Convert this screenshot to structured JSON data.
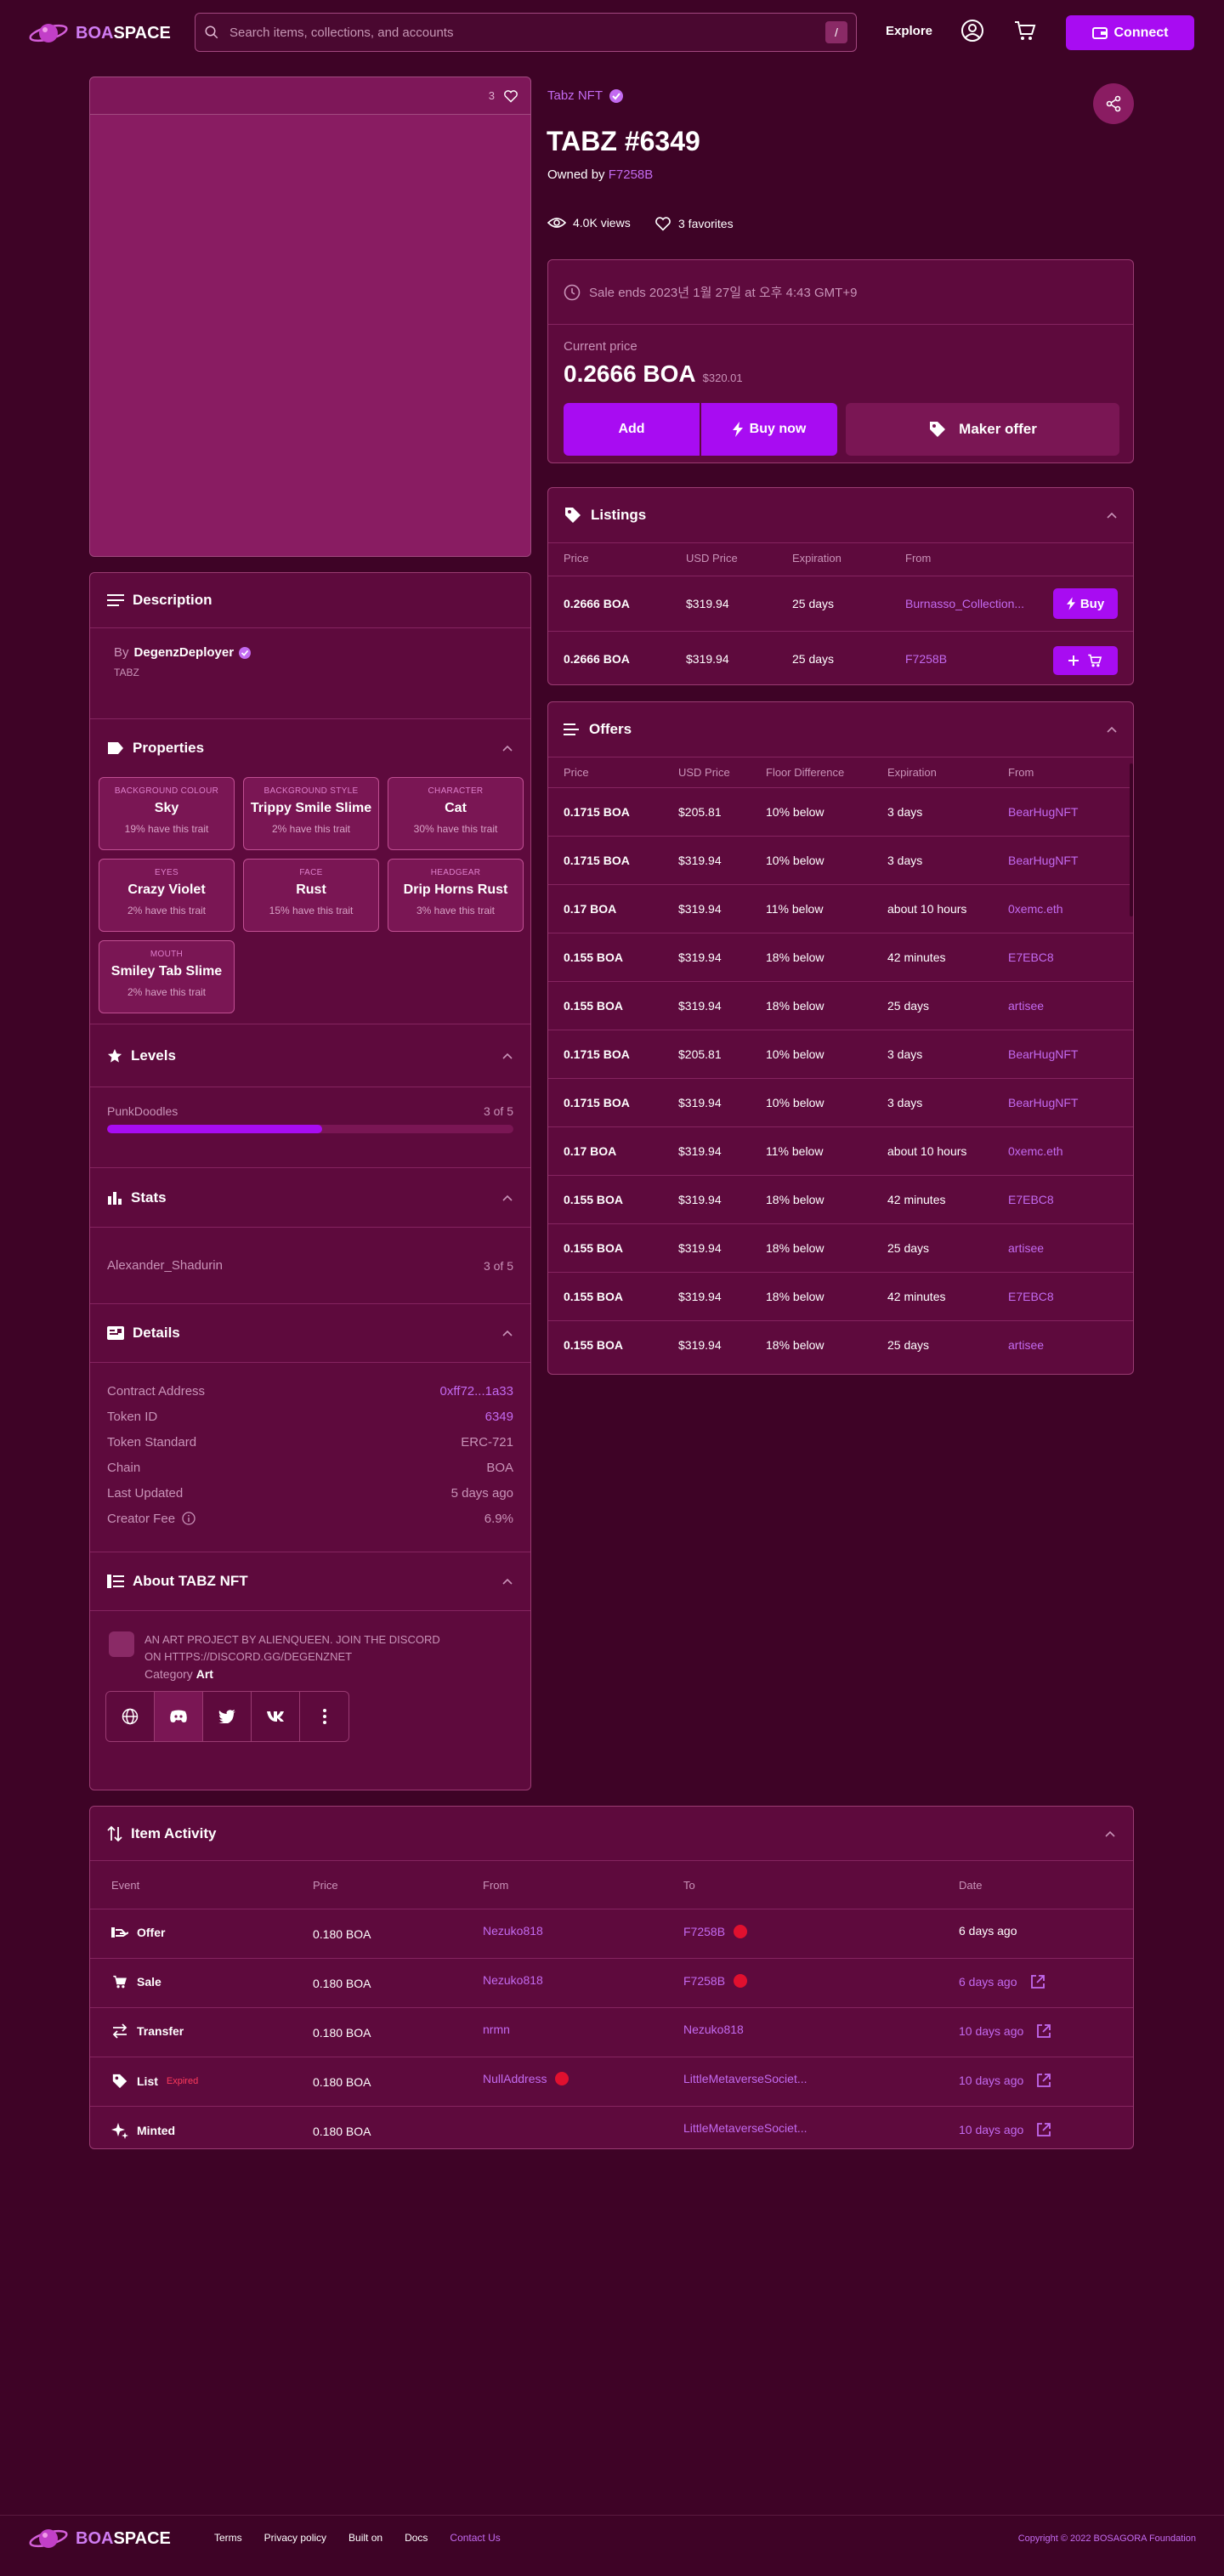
{
  "header": {
    "logo_boa": "BOA",
    "logo_space": "SPACE",
    "search_placeholder": "Search items, collections, and accounts",
    "search_shortcut": "/",
    "nav_explore": "Explore",
    "connect_label": "Connect"
  },
  "media": {
    "favorite_count": "3"
  },
  "item": {
    "collection": "Tabz NFT",
    "title": "TABZ #6349",
    "owned_by_label": "Owned by",
    "owner": "F7258B",
    "views": "4.0K views",
    "favorites": "3 favorites"
  },
  "sale": {
    "ends": "Sale ends 2023년 1월 27일 at 오후 4:43 GMT+9",
    "current_price_label": "Current price",
    "price": "0.2666 BOA",
    "usd": "$320.01",
    "add_label": "Add",
    "buy_now_label": "Buy now",
    "make_offer_label": "Maker offer"
  },
  "listings": {
    "title": "Listings",
    "headers": [
      "Price",
      "USD Price",
      "Expiration",
      "From"
    ],
    "rows": [
      {
        "price": "0.2666 BOA",
        "usd": "$319.94",
        "exp": "25 days",
        "from": "Burnasso_Collection...",
        "action": "Buy"
      },
      {
        "price": "0.2666 BOA",
        "usd": "$319.94",
        "exp": "25 days",
        "from": "F7258B",
        "action": ""
      }
    ]
  },
  "offers": {
    "title": "Offers",
    "headers": [
      "Price",
      "USD Price",
      "Floor Difference",
      "Expiration",
      "From"
    ],
    "rows": [
      {
        "price": "0.1715 BOA",
        "usd": "$205.81",
        "floor": "10% below",
        "exp": "3 days",
        "from": "BearHugNFT"
      },
      {
        "price": "0.1715 BOA",
        "usd": "$319.94",
        "floor": "10% below",
        "exp": "3 days",
        "from": "BearHugNFT"
      },
      {
        "price": "0.17 BOA",
        "usd": "$319.94",
        "floor": "11% below",
        "exp": "about 10 hours",
        "from": "0xemc.eth"
      },
      {
        "price": "0.155 BOA",
        "usd": "$319.94",
        "floor": "18% below",
        "exp": "42 minutes",
        "from": "E7EBC8"
      },
      {
        "price": "0.155 BOA",
        "usd": "$319.94",
        "floor": "18% below",
        "exp": "25 days",
        "from": "artisee"
      },
      {
        "price": "0.1715 BOA",
        "usd": "$205.81",
        "floor": "10% below",
        "exp": "3 days",
        "from": "BearHugNFT"
      },
      {
        "price": "0.1715 BOA",
        "usd": "$319.94",
        "floor": "10% below",
        "exp": "3 days",
        "from": "BearHugNFT"
      },
      {
        "price": "0.17 BOA",
        "usd": "$319.94",
        "floor": "11% below",
        "exp": "about 10 hours",
        "from": "0xemc.eth"
      },
      {
        "price": "0.155 BOA",
        "usd": "$319.94",
        "floor": "18% below",
        "exp": "42 minutes",
        "from": "E7EBC8"
      },
      {
        "price": "0.155 BOA",
        "usd": "$319.94",
        "floor": "18% below",
        "exp": "25 days",
        "from": "artisee"
      },
      {
        "price": "0.155 BOA",
        "usd": "$319.94",
        "floor": "18% below",
        "exp": "42 minutes",
        "from": "E7EBC8"
      },
      {
        "price": "0.155 BOA",
        "usd": "$319.94",
        "floor": "18% below",
        "exp": "25 days",
        "from": "artisee"
      }
    ]
  },
  "description": {
    "title": "Description",
    "by_label": "By",
    "creator": "DegenzDeployer",
    "text": "TABZ"
  },
  "properties": {
    "title": "Properties",
    "items": [
      {
        "type": "BACKGROUND COLOUR",
        "value": "Sky",
        "pct": "19% have this trait"
      },
      {
        "type": "BACKGROUND STYLE",
        "value": "Trippy Smile Slime",
        "pct": "2% have this trait"
      },
      {
        "type": "CHARACTER",
        "value": "Cat",
        "pct": "30% have this trait"
      },
      {
        "type": "EYES",
        "value": "Crazy Violet",
        "pct": "2% have this trait"
      },
      {
        "type": "FACE",
        "value": "Rust",
        "pct": "15% have this trait"
      },
      {
        "type": "HEADGEAR",
        "value": "Drip Horns Rust",
        "pct": "3% have this trait"
      },
      {
        "type": "MOUTH",
        "value": "Smiley Tab Slime",
        "pct": "2% have this trait"
      }
    ]
  },
  "levels": {
    "title": "Levels",
    "name": "PunkDoodles",
    "value_text": "3 of 5",
    "fraction": 0.53
  },
  "stats": {
    "title": "Stats",
    "name": "Alexander_Shadurin",
    "value_text": "3 of 5"
  },
  "details": {
    "title": "Details",
    "rows": [
      {
        "label": "Contract Address",
        "value": "0xff72...1a33",
        "link": true
      },
      {
        "label": "Token ID",
        "value": "6349",
        "link": true
      },
      {
        "label": "Token Standard",
        "value": "ERC-721",
        "link": false
      },
      {
        "label": "Chain",
        "value": "BOA",
        "link": false
      },
      {
        "label": "Last Updated",
        "value": "5 days ago",
        "link": false
      },
      {
        "label": "Creator Fee",
        "value": "6.9%",
        "link": false
      }
    ]
  },
  "about": {
    "title": "About TABZ NFT",
    "text1": "AN ART PROJECT BY ALIENQUEEN. JOIN THE DISCORD",
    "text2": "ON HTTPS://DISCORD.GG/DEGENZNET",
    "category_label": "Category",
    "category": "Art"
  },
  "activity": {
    "title": "Item Activity",
    "headers": [
      "Event",
      "Price",
      "From",
      "To",
      "Date"
    ],
    "rows": [
      {
        "event": "Offer",
        "badge": "",
        "price": "0.180 BOA",
        "from": "Nezuko818",
        "from_dot": false,
        "to": "F7258B",
        "to_dot": true,
        "date": "6 days ago",
        "date_link": false
      },
      {
        "event": "Sale",
        "badge": "",
        "price": "0.180 BOA",
        "from": "Nezuko818",
        "from_dot": false,
        "to": "F7258B",
        "to_dot": true,
        "date": "6 days ago",
        "date_link": true
      },
      {
        "event": "Transfer",
        "badge": "",
        "price": "0.180 BOA",
        "from": "nrmn",
        "from_dot": false,
        "to": "Nezuko818",
        "to_dot": false,
        "date": "10 days ago",
        "date_link": true
      },
      {
        "event": "List",
        "badge": "Expired",
        "price": "0.180 BOA",
        "from": "NullAddress",
        "from_dot": true,
        "to": "LittleMetaverseSociet...",
        "to_dot": false,
        "date": "10 days ago",
        "date_link": true
      },
      {
        "event": "Minted",
        "badge": "",
        "price": "0.180 BOA",
        "from": "",
        "from_dot": false,
        "to": "LittleMetaverseSociet...",
        "to_dot": false,
        "date": "10 days ago",
        "date_link": true
      }
    ]
  },
  "footer": {
    "links": [
      "Terms",
      "Privacy policy",
      "Built on",
      "Docs",
      "Contact Us"
    ],
    "copyright": "Copyright © 2022 BOSAGORA Foundation"
  },
  "colors": {
    "background": "#3e0326",
    "panel": "#5e0a3d",
    "accent": "#a80cf2",
    "link": "#c36af0",
    "verified": "#c36af0",
    "alert": "#e0102f"
  }
}
